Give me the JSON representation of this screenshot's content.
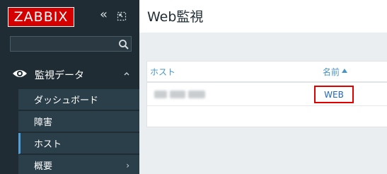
{
  "sidebar": {
    "logo": "ZABBIX",
    "collapse_glyph": "«",
    "search_placeholder": "",
    "section": {
      "label": "監視データ",
      "icon": "eye-icon",
      "items": [
        {
          "label": "ダッシュボード"
        },
        {
          "label": "障害"
        },
        {
          "label": "ホスト",
          "active": true
        },
        {
          "label": "概要",
          "has_submenu": true
        }
      ]
    }
  },
  "main": {
    "title": "Web監視",
    "table": {
      "columns": [
        "ホスト",
        "名前"
      ],
      "rows": [
        {
          "name": "WEB"
        }
      ]
    }
  },
  "colors": {
    "sidebar_bg": "#1f2c33",
    "submenu_bg": "#2b3f4b",
    "accent": "#4796c4",
    "logo_red": "#d40000",
    "highlight_red": "#e00000"
  }
}
